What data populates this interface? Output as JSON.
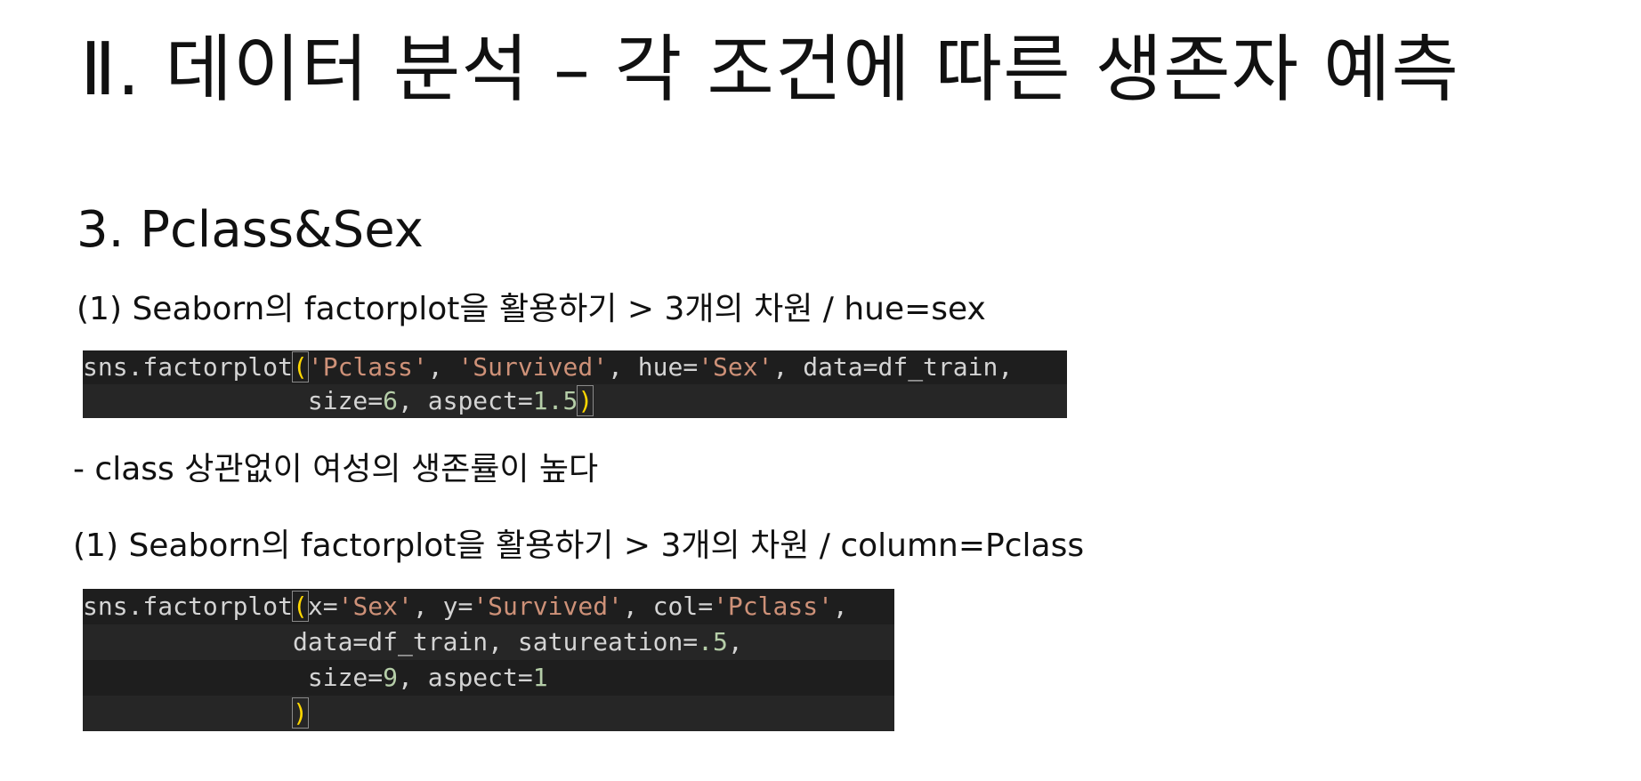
{
  "slide": {
    "title": "Ⅱ. 데이터 분석 – 각 조건에 따른 생존자 예측",
    "section_heading": "3. Pclass&Sex",
    "para1": "(1) Seaborn의 factorplot을 활용하기 > 3개의 차원 / hue=sex",
    "para2": "- class 상관없이 여성의 생존률이 높다",
    "para3": "(1) Seaborn의 factorplot을 활용하기 > 3개의 차원 / column=Pclass"
  },
  "code1": {
    "line1": [
      {
        "t": "sns.factorplot",
        "k": "plain"
      },
      {
        "t": "(",
        "k": "paren"
      },
      {
        "t": "'Pclass'",
        "k": "str"
      },
      {
        "t": ", ",
        "k": "plain"
      },
      {
        "t": "'Survived'",
        "k": "str"
      },
      {
        "t": ", hue=",
        "k": "plain"
      },
      {
        "t": "'Sex'",
        "k": "str"
      },
      {
        "t": ", data=df_train,",
        "k": "plain"
      }
    ],
    "line2": [
      {
        "t": "               size=",
        "k": "plain"
      },
      {
        "t": "6",
        "k": "num"
      },
      {
        "t": ", aspect=",
        "k": "plain"
      },
      {
        "t": "1.5",
        "k": "num"
      },
      {
        "t": ")",
        "k": "paren"
      }
    ]
  },
  "code2": {
    "line1": [
      {
        "t": "sns.factorplot",
        "k": "plain"
      },
      {
        "t": "(",
        "k": "paren"
      },
      {
        "t": "x=",
        "k": "plain"
      },
      {
        "t": "'Sex'",
        "k": "str"
      },
      {
        "t": ", y=",
        "k": "plain"
      },
      {
        "t": "'Survived'",
        "k": "str"
      },
      {
        "t": ", col=",
        "k": "plain"
      },
      {
        "t": "'Pclass'",
        "k": "str"
      },
      {
        "t": ",",
        "k": "plain"
      }
    ],
    "line2": [
      {
        "t": "              data=df_train, satureation=",
        "k": "plain"
      },
      {
        "t": ".5",
        "k": "num"
      },
      {
        "t": ",",
        "k": "plain"
      }
    ],
    "line3": [
      {
        "t": "               size=",
        "k": "plain"
      },
      {
        "t": "9",
        "k": "num"
      },
      {
        "t": ", aspect=",
        "k": "plain"
      },
      {
        "t": "1",
        "k": "num"
      }
    ],
    "line4": [
      {
        "t": "              ",
        "k": "plain"
      },
      {
        "t": ")",
        "k": "paren"
      }
    ]
  },
  "colors": {
    "code_background": "#1e1e1e",
    "code_text": "#d4d4d4",
    "string": "#ce9178",
    "number": "#b5cea8",
    "bracket": "#ffd700"
  }
}
